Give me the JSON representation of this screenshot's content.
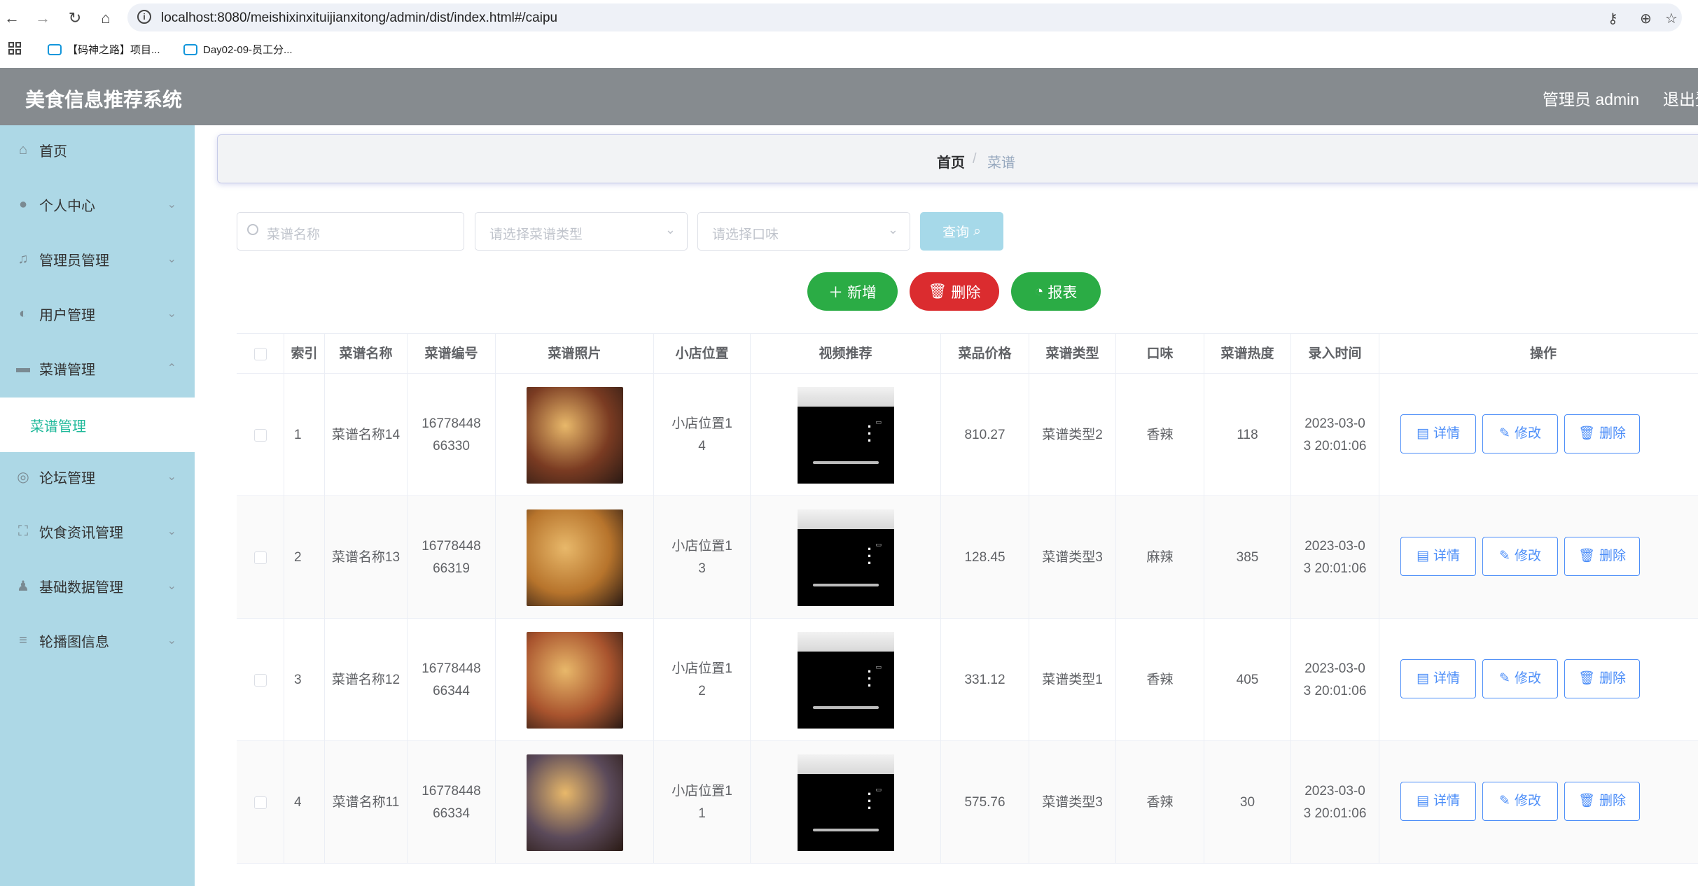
{
  "browser": {
    "url": "localhost:8080/meishixinxituijianxitong/admin/dist/index.html#/caipu",
    "bookmarks": [
      "【码神之路】项目...",
      "Day02-09-员工分..."
    ]
  },
  "header": {
    "title": "美食信息推荐系统",
    "user": "管理员 admin",
    "logout": "退出登"
  },
  "sidebar": {
    "items": [
      {
        "label": "首页",
        "icon": "home-icon"
      },
      {
        "label": "个人中心",
        "icon": "user-icon"
      },
      {
        "label": "管理员管理",
        "icon": "bell-icon"
      },
      {
        "label": "用户管理",
        "icon": "user-group-icon"
      },
      {
        "label": "菜谱管理",
        "icon": "book-icon"
      },
      {
        "label": "论坛管理",
        "icon": "compass-icon"
      },
      {
        "label": "饮食资讯管理",
        "icon": "fullscreen-icon"
      },
      {
        "label": "基础数据管理",
        "icon": "person-icon"
      },
      {
        "label": "轮播图信息",
        "icon": "list-icon"
      }
    ],
    "submenu_label": "菜谱管理"
  },
  "breadcrumb": {
    "home": "首页",
    "separator": "/",
    "current": "菜谱"
  },
  "search": {
    "name_placeholder": "菜谱名称",
    "type_placeholder": "请选择菜谱类型",
    "taste_placeholder": "请选择口味",
    "query_label": "查询"
  },
  "actions": {
    "add": "新增",
    "delete": "删除",
    "report": "报表"
  },
  "table": {
    "columns": [
      "索引",
      "菜谱名称",
      "菜谱编号",
      "菜谱照片",
      "小店位置",
      "视频推荐",
      "菜品价格",
      "菜谱类型",
      "口味",
      "菜谱热度",
      "录入时间",
      "操作"
    ],
    "rows": [
      {
        "index": "1",
        "name": "菜谱名称14",
        "code": "1677844866330",
        "location": "小店位置14",
        "price": "810.27",
        "type": "菜谱类型2",
        "taste": "香辣",
        "heat": "118",
        "time": "2023-03-03 20:01:06"
      },
      {
        "index": "2",
        "name": "菜谱名称13",
        "code": "1677844866319",
        "location": "小店位置13",
        "price": "128.45",
        "type": "菜谱类型3",
        "taste": "麻辣",
        "heat": "385",
        "time": "2023-03-03 20:01:06"
      },
      {
        "index": "3",
        "name": "菜谱名称12",
        "code": "1677844866344",
        "location": "小店位置12",
        "price": "331.12",
        "type": "菜谱类型1",
        "taste": "香辣",
        "heat": "405",
        "time": "2023-03-03 20:01:06"
      },
      {
        "index": "4",
        "name": "菜谱名称11",
        "code": "1677844866334",
        "location": "小店位置11",
        "price": "575.76",
        "type": "菜谱类型3",
        "taste": "香辣",
        "heat": "30",
        "time": "2023-03-03 20:01:06"
      }
    ],
    "row_buttons": {
      "detail": "详情",
      "edit": "修改",
      "delete": "删除"
    },
    "photo_colors": [
      "#7a3b22",
      "#b7742c",
      "#a9542e",
      "#5b4a5a"
    ]
  }
}
